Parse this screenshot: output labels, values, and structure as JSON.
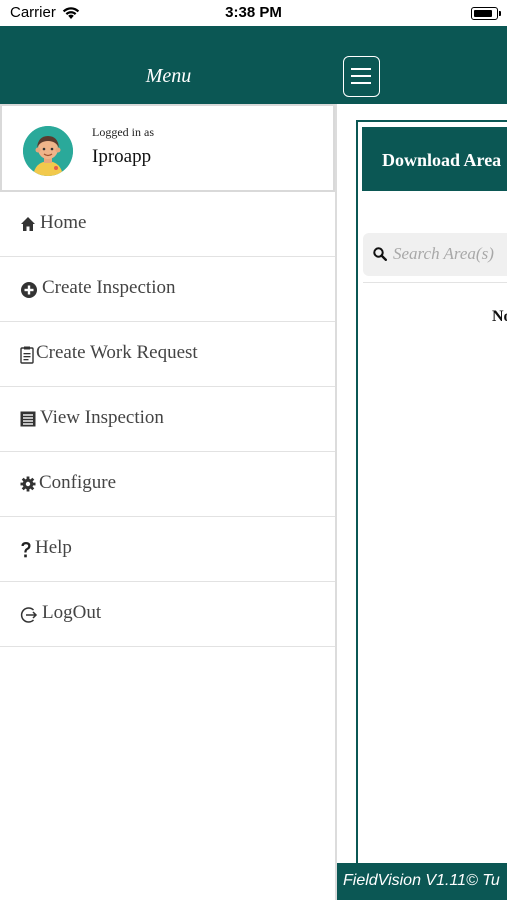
{
  "status_bar": {
    "carrier": "Carrier",
    "time": "3:38 PM",
    "battery_level": 0.9
  },
  "header": {
    "menu_title": "Menu",
    "hamburger_icon": "hamburger-icon",
    "color": "#0b5754"
  },
  "profile": {
    "logged_in_label": "Logged in as",
    "user_name": "Iproapp",
    "avatar_icon": "avatar"
  },
  "nav": {
    "items": [
      {
        "label": "Home",
        "icon": "home-icon"
      },
      {
        "label": "Create Inspection",
        "icon": "plus-circle-icon"
      },
      {
        "label": "Create Work Request",
        "icon": "clipboard-icon"
      },
      {
        "label": "View Inspection",
        "icon": "list-icon"
      },
      {
        "label": "Configure",
        "icon": "gear-icon"
      },
      {
        "label": "Help",
        "icon": "question-icon"
      },
      {
        "label": "LogOut",
        "icon": "logout-icon"
      }
    ]
  },
  "content": {
    "panel_title": "Download Area",
    "search_placeholder": "Search Area(s)",
    "empty_text": "No"
  },
  "footer": {
    "text": "FieldVision V1.11© Tu"
  }
}
